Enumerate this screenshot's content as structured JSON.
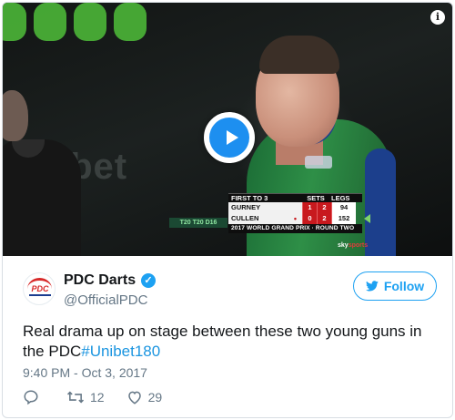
{
  "video": {
    "info_icon": "info-icon",
    "play_icon": "play-icon",
    "scoreboard": {
      "header_title": "FIRST TO 3",
      "header_sets": "SETS",
      "header_legs": "LEGS",
      "rows": [
        {
          "name": "GURNEY",
          "indicator": "",
          "sets": "1",
          "legs": "2",
          "score": "94"
        },
        {
          "name": "CULLEN",
          "indicator": "•",
          "sets": "0",
          "legs": "2",
          "score": "152"
        }
      ],
      "footer": "2017 WORLD GRAND PRIX · ROUND TWO"
    },
    "checkout": "T20 T20 D16",
    "broadcaster": {
      "sky": "sky",
      "sports": "sports"
    },
    "background_text": "ibet",
    "colors": {
      "score_red": "#c8191e",
      "play_blue": "#1d8ff0"
    }
  },
  "tweet": {
    "display_name": "PDC Darts",
    "logo_text": "PDC",
    "handle": "@OfficialPDC",
    "verified_icon": "verified-badge-icon",
    "follow_label": "Follow",
    "text_before": "Real drama up on stage between these two young guns in the PDC",
    "hashtag": "#Unibet180",
    "timestamp": "9:40 PM - Oct 3, 2017",
    "actions": {
      "reply_count": "",
      "retweet_count": "12",
      "like_count": "29"
    },
    "colors": {
      "link_blue": "#1da1f2",
      "muted": "#657786"
    }
  }
}
